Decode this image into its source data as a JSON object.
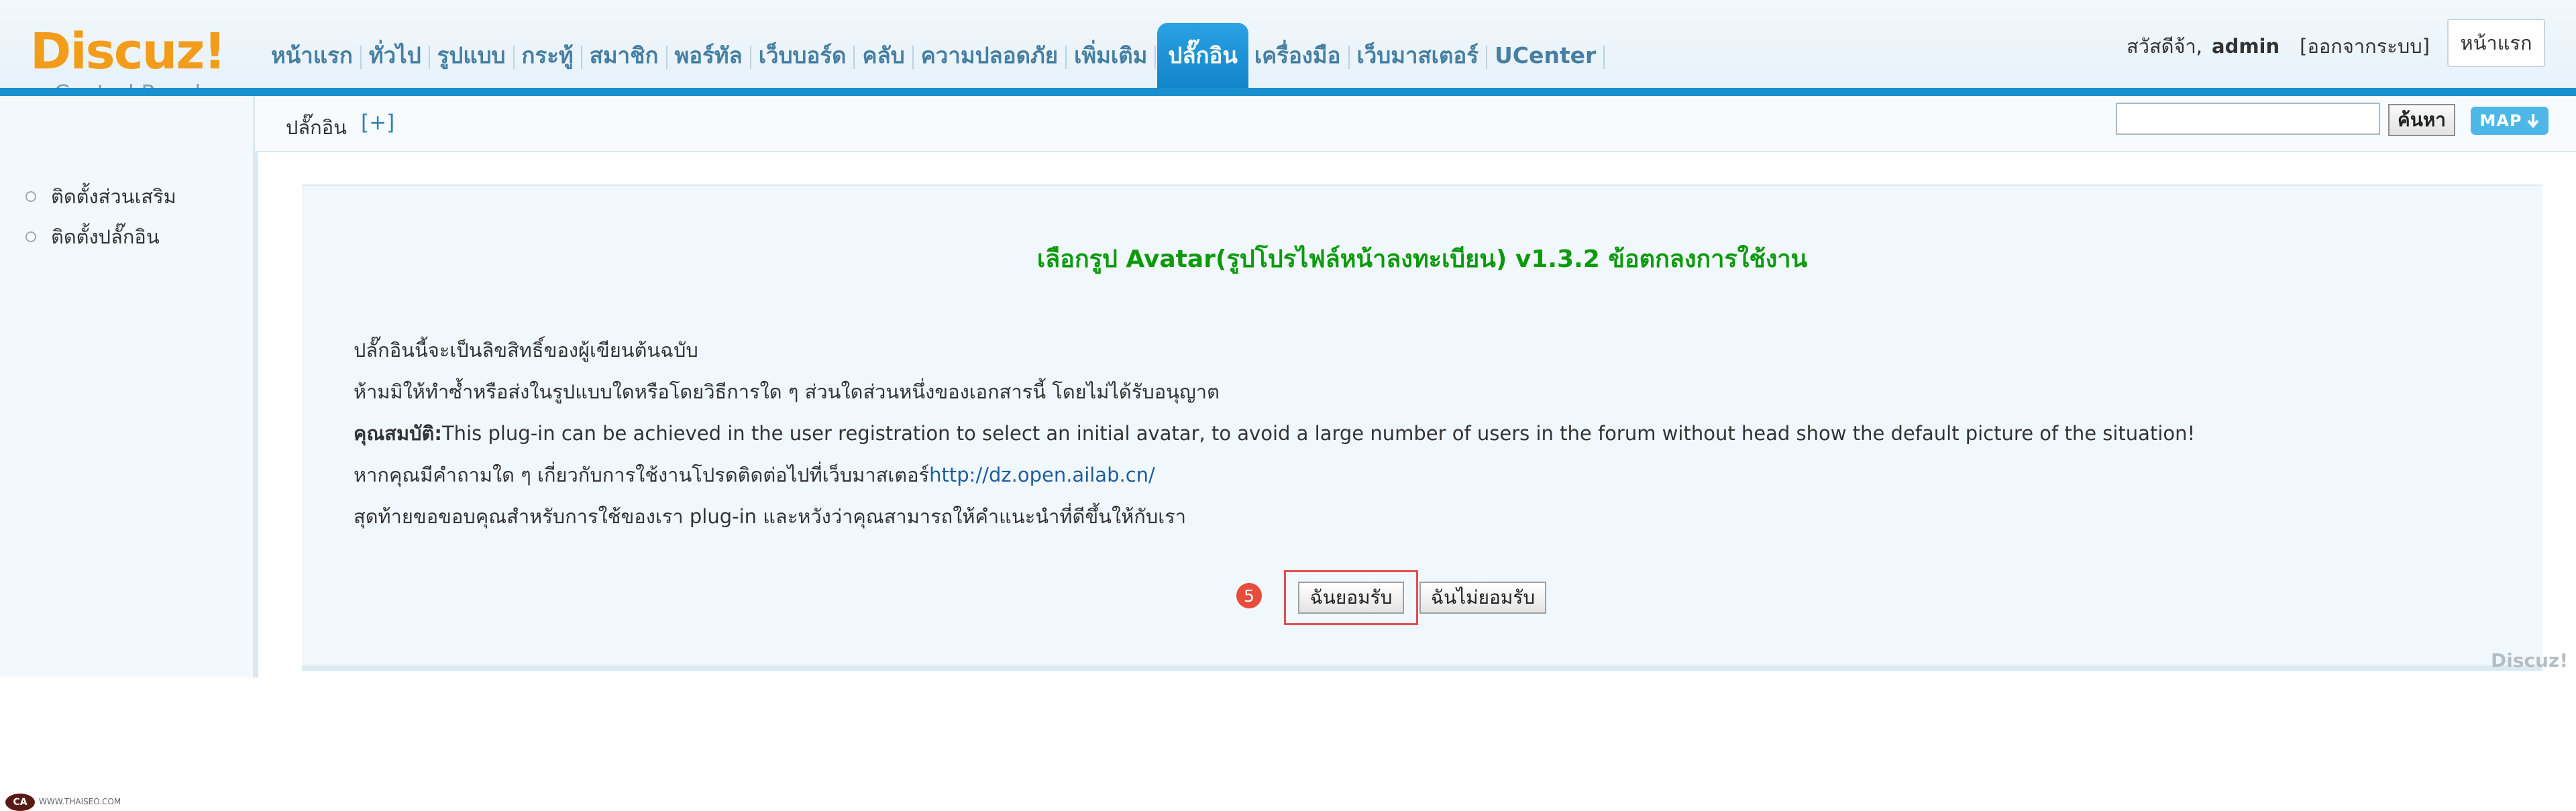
{
  "header": {
    "logo": {
      "brand": "Discuz!",
      "subtitle": "Control Panel"
    },
    "nav_tabs": [
      {
        "label": "หน้าแรก"
      },
      {
        "label": "ทั่วไป"
      },
      {
        "label": "รูปแบบ"
      },
      {
        "label": "กระทู้"
      },
      {
        "label": "สมาชิก"
      },
      {
        "label": "พอร์ทัล"
      },
      {
        "label": "เว็บบอร์ด"
      },
      {
        "label": "คลับ"
      },
      {
        "label": "ความปลอดภัย"
      },
      {
        "label": "เพิ่มเติม"
      },
      {
        "label": "ปลั๊กอิน",
        "active": true
      },
      {
        "label": "เครื่องมือ"
      },
      {
        "label": "เว็บมาสเตอร์"
      },
      {
        "label": "UCenter"
      }
    ],
    "greeting": "สวัสดีจ้า,",
    "username": "admin",
    "logout": "[ออกจากระบบ]",
    "home_button": "หน้าแรก",
    "accent_color": "#1a8fcf"
  },
  "subheader": {
    "breadcrumb": "ปลั๊กอิน",
    "add_link": "[+]",
    "search": {
      "value": "",
      "placeholder": ""
    },
    "search_button": "ค้นหา",
    "map_button": "MAP"
  },
  "sidebar": {
    "items": [
      {
        "label": "ติดตั้งส่วนเสริม"
      },
      {
        "label": "ติดตั้งปลั๊กอิน"
      }
    ],
    "corner_logo_text": "WWW.THAISEO.COM"
  },
  "main": {
    "title": "เลือกรูป Avatar(รูปโปรไฟล์หน้าลงทะเบียน) v1.3.2 ข้อตกลงการใช้งาน",
    "lines": [
      "ปลั๊กอินนี้จะเป็นลิขสิทธิ์ของผู้เขียนต้นฉบับ",
      "ห้ามมิให้ทำซ้ำหรือส่งในรูปแบบใดหรือโดยวิธีการใด ๆ ส่วนใดส่วนหนึ่งของเอกสารนี้ โดยไม่ได้รับอนุญาต"
    ],
    "feature_label": "คุณสมบัติ:",
    "feature_text": "This plug-in can be achieved in the user registration to select an initial avatar, to avoid a large number of users in the forum without head show the default picture of the situation!",
    "contact_text": "หากคุณมีคำถามใด ๆ เกี่ยวกับการใช้งานโปรดติดต่อไปที่เว็บมาสเตอร์",
    "contact_link": "http://dz.open.ailab.cn/",
    "closing_text": "สุดท้ายขอขอบคุณสำหรับการใช้ของเรา plug-in และหวังว่าคุณสามารถให้คำแนะนำที่ดีขึ้นให้กับเรา",
    "step_number": "5",
    "accept_button": "ฉันยอมรับ",
    "decline_button": "ฉันไม่ยอมรับ",
    "title_color": "#0c9a0c"
  },
  "watermark": "Discuz!"
}
